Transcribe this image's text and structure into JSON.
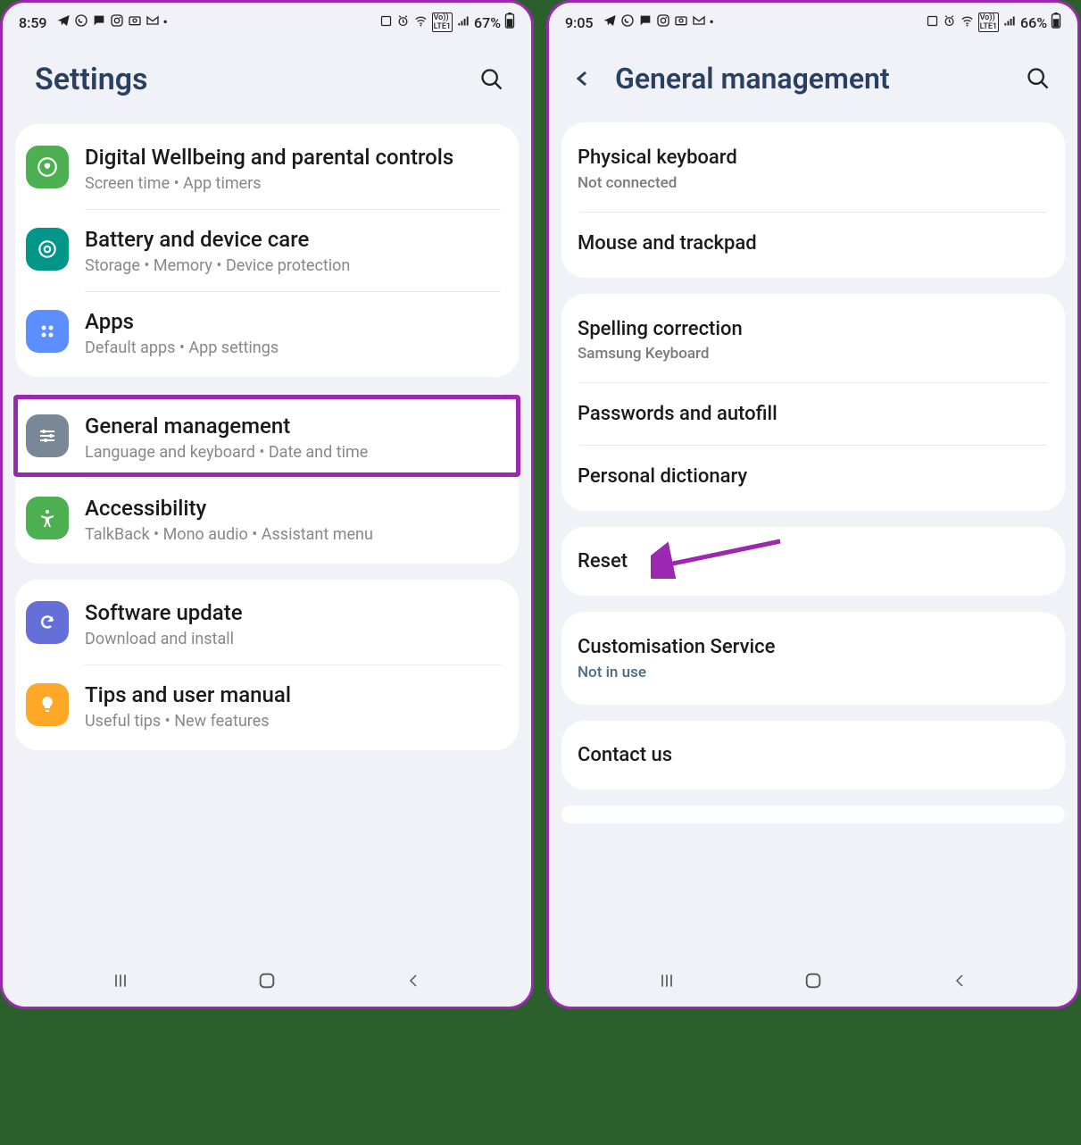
{
  "left": {
    "statusbar": {
      "time": "8:59",
      "battery": "67%"
    },
    "header": {
      "title": "Settings"
    },
    "groups": [
      {
        "items": [
          {
            "icon": "wellbeing",
            "title": "Digital Wellbeing and parental controls",
            "subtitle": "Screen time  •  App timers"
          },
          {
            "icon": "battery",
            "title": "Battery and device care",
            "subtitle": "Storage  •  Memory  •  Device protection"
          },
          {
            "icon": "apps",
            "title": "Apps",
            "subtitle": "Default apps  •  App settings"
          }
        ]
      },
      {
        "items": [
          {
            "icon": "general",
            "title": "General management",
            "subtitle": "Language and keyboard  •  Date and time",
            "highlighted": true
          },
          {
            "icon": "accessibility",
            "title": "Accessibility",
            "subtitle": "TalkBack  •  Mono audio  •  Assistant menu"
          }
        ]
      },
      {
        "items": [
          {
            "icon": "update",
            "title": "Software update",
            "subtitle": "Download and install"
          },
          {
            "icon": "tips",
            "title": "Tips and user manual",
            "subtitle": "Useful tips  •  New features"
          }
        ]
      }
    ]
  },
  "right": {
    "statusbar": {
      "time": "9:05",
      "battery": "66%"
    },
    "header": {
      "title": "General management"
    },
    "groups": [
      {
        "items": [
          {
            "title": "Physical keyboard",
            "subtitle": "Not connected"
          },
          {
            "title": "Mouse and trackpad"
          }
        ]
      },
      {
        "items": [
          {
            "title": "Spelling correction",
            "subtitle": "Samsung Keyboard"
          },
          {
            "title": "Passwords and autofill"
          },
          {
            "title": "Personal dictionary"
          }
        ]
      },
      {
        "items": [
          {
            "title": "Reset",
            "arrow": true
          }
        ]
      },
      {
        "items": [
          {
            "title": "Customisation Service",
            "subtitle": "Not in use",
            "subBlue": true
          }
        ]
      },
      {
        "items": [
          {
            "title": "Contact us"
          }
        ]
      }
    ]
  }
}
